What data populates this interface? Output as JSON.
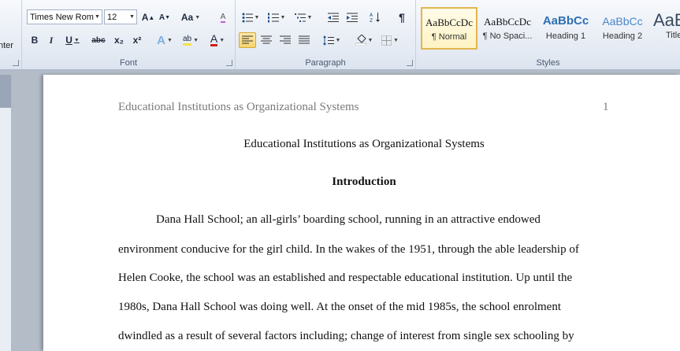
{
  "ribbon": {
    "clipboard": {
      "cut_fragment": "nter"
    },
    "font": {
      "label": "Font",
      "font_name": "Times New Rom",
      "font_size": "12",
      "grow": "A",
      "shrink": "A",
      "change_case": "Aa",
      "clear_format": "A",
      "bold": "B",
      "italic": "I",
      "underline": "U",
      "strike": "abc",
      "subscript": "x₂",
      "superscript": "x²",
      "text_effects": "A",
      "highlight": "ab",
      "font_color": "A"
    },
    "paragraph": {
      "label": "Paragraph",
      "show_marks": "¶"
    },
    "styles": {
      "label": "Styles",
      "items": [
        {
          "preview": "AaBbCcDc",
          "name": "¶ Normal"
        },
        {
          "preview": "AaBbCcDc",
          "name": "¶ No Spaci..."
        },
        {
          "preview": "AaBbCc",
          "name": "Heading 1"
        },
        {
          "preview": "AaBbCc",
          "name": "Heading 2"
        },
        {
          "preview": "AaB",
          "name": "Title"
        }
      ]
    }
  },
  "colors": {
    "highlight": "#f4e14a",
    "font_color": "#d0201b",
    "selected_border": "#e2b64d"
  },
  "document": {
    "header_title": "Educational Institutions as Organizational Systems",
    "page_number": "1",
    "title": "Educational Institutions as Organizational Systems",
    "section_heading": "Introduction",
    "body_lines": [
      "Dana Hall School; an all-girls’ boarding school, running in an attractive endowed",
      "environment conducive for the girl child. In the wakes of the 1951, through the able leadership of",
      "Helen Cooke, the school was an established and respectable educational institution. Up until the",
      "1980s, Dana Hall School was doing well. At the onset of the mid 1985s, the school enrolment",
      "dwindled as a result of several factors including; change of interest from single sex schooling by"
    ]
  }
}
